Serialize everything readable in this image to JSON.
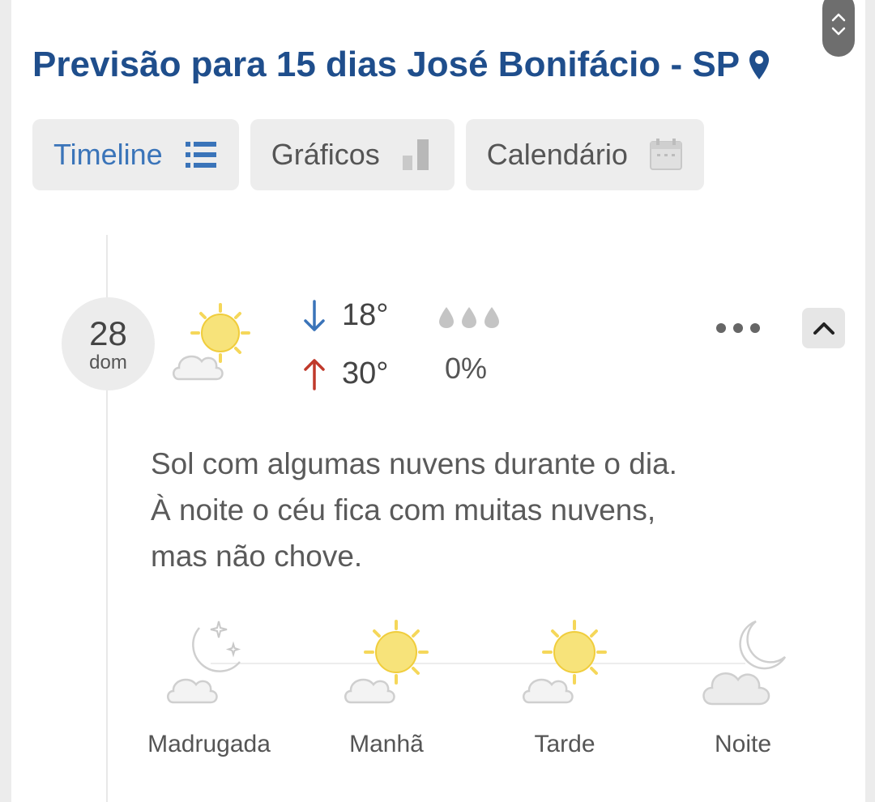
{
  "header": {
    "title": "Previsão para 15 dias José Bonifácio - SP"
  },
  "tabs": [
    {
      "label": "Timeline",
      "icon": "list-icon",
      "active": true
    },
    {
      "label": "Gráficos",
      "icon": "bar-chart-icon",
      "active": false
    },
    {
      "label": "Calendário",
      "icon": "calendar-icon",
      "active": false
    }
  ],
  "day": {
    "number": "28",
    "weekday": "dom",
    "icon": "sun-cloud-icon",
    "temp_min": "18°",
    "temp_max": "30°",
    "rain_probability": "0%",
    "description": "Sol com algumas nuvens durante o dia. À noite o céu fica com muitas nuvens, mas não chove."
  },
  "periods": [
    {
      "label": "Madrugada",
      "icon": "moon-cloud-stars-icon"
    },
    {
      "label": "Manhã",
      "icon": "sun-cloud-icon"
    },
    {
      "label": "Tarde",
      "icon": "sun-cloud-icon"
    },
    {
      "label": "Noite",
      "icon": "moon-cloud-icon"
    }
  ],
  "colors": {
    "title": "#1f4e8c",
    "active_tab": "#3a74b9",
    "arrow_down": "#3a74b9",
    "arrow_up": "#c0392b",
    "sun": "#f7e37a"
  }
}
